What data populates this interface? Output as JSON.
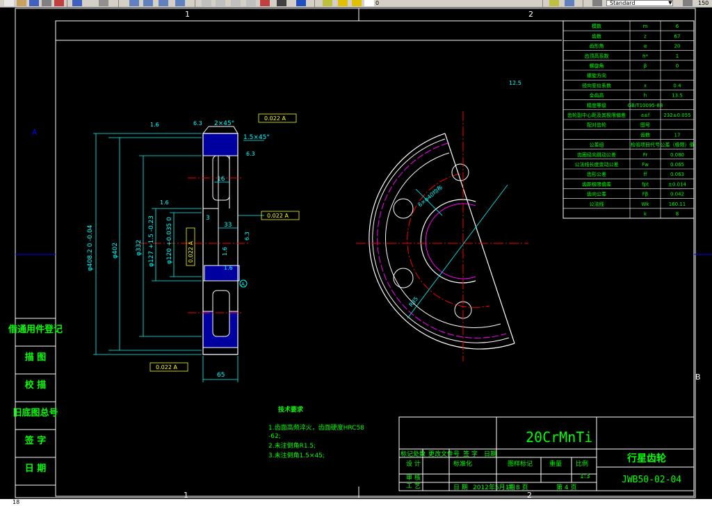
{
  "toolbar": {
    "style_combo": "Standard",
    "zoom": "150",
    "layer_value": "0"
  },
  "colors": {
    "background": "#000000",
    "frame": "#ffffff",
    "dim": "#00ffff",
    "center": "#ff0000",
    "table": "#00ff00",
    "pitch_circle": "#ff00ff",
    "hatch": "#0000ff",
    "annotation": "#ff0000"
  },
  "drawing": {
    "zone_top": [
      "1",
      "2"
    ],
    "zone_bottom": [
      "1",
      "2"
    ],
    "zone_side": [
      "A",
      "B"
    ],
    "left_column": [
      "借通用件登记",
      "描 图",
      "校 描",
      "旧底图总号",
      "签 字",
      "日 期"
    ],
    "param_table": [
      [
        "模数",
        "m",
        "6"
      ],
      [
        "齿数",
        "z",
        "67"
      ],
      [
        "齿形角",
        "α",
        "20"
      ],
      [
        "齿顶高系数",
        "h*",
        "1"
      ],
      [
        "螺旋角",
        "β",
        "0"
      ],
      [
        "螺旋方向",
        "",
        ""
      ],
      [
        "径向变位系数",
        "x",
        "0.4"
      ],
      [
        "全齿高",
        "h",
        "13.5"
      ],
      [
        "精度等级",
        "GB/T10095-88",
        ""
      ],
      [
        "齿轮副中心距及其极限偏差",
        "a±f",
        "232±0.055"
      ],
      [
        "配对齿轮",
        "图号",
        ""
      ],
      [
        "",
        "齿数",
        "17"
      ],
      [
        "公差组",
        "检验项目代号",
        "公差（极限）值"
      ],
      [
        "齿圈径向跳动公差",
        "Fr",
        "0.080"
      ],
      [
        "公法线长度变动公差",
        "Fw",
        "0.065"
      ],
      [
        "齿形公差",
        "ff",
        "0.063"
      ],
      [
        "齿距极限偏差",
        "fpt",
        "±0.014"
      ],
      [
        "齿向公差",
        "Fβ",
        "0.042"
      ],
      [
        "公法线",
        "Wk",
        "160.11"
      ],
      [
        "",
        "k",
        "8"
      ]
    ],
    "dimensions": {
      "d_tip": "φ408.2 0 -0.04",
      "d_root": "φ402",
      "d_web": "φ332",
      "d_bore1": "φ127 +1.5 -0.23",
      "d_bore2": "φ120 +0.035 0",
      "width": "65",
      "hub": "33",
      "web": "16",
      "step": "3",
      "chamfer": "2×45°",
      "chamfer2": "1.5×45°",
      "radius": "R35",
      "holes": "6×φ40均布"
    },
    "roughness": [
      "1.6",
      "6.3",
      "6.3",
      "1.6",
      "6.3",
      "1.6",
      "1.6",
      "12.5"
    ],
    "tolerances": [
      "0.022 A",
      "0.022 A",
      "0.022 A",
      "0.022 A"
    ],
    "datum": "A",
    "tech_req": {
      "title": "技术要求",
      "items": [
        "1.齿面高频淬火，齿面硬度HRC58",
        "-62;",
        "2.未注倒角R1.5;",
        "3.未注倒角1.5×45;"
      ]
    },
    "title_block": {
      "material": "20CrMnTi",
      "part_name": "行星齿轮",
      "drawing_no": "JWB50-02-04",
      "scale_label": "比例",
      "scale": "1:3",
      "sheets": "共 8 页",
      "sheet": "第 4 页",
      "rev_header": [
        "标记",
        "处数",
        "更改文件号",
        "签 字",
        "日期"
      ],
      "sign_rows": [
        "设 计",
        "审 核",
        "工 艺"
      ],
      "standardize": "标准化",
      "date_label": "日 期",
      "date": "2012年5月1日",
      "mark_labels": [
        "图样标记",
        "重量",
        "比 例"
      ]
    }
  },
  "status": {
    "text": "18"
  }
}
